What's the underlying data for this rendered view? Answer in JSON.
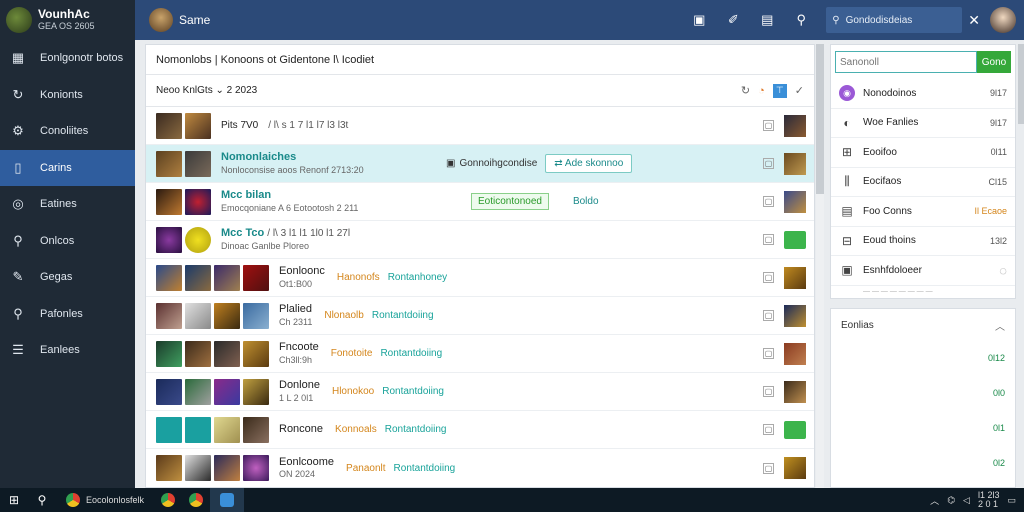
{
  "brand": {
    "title": "VounhAc",
    "subtitle": "GEA OS 2605"
  },
  "sidebar": {
    "items": [
      {
        "label": "Eonlgonotr botos",
        "icon": "grid-icon"
      },
      {
        "label": "Konionts",
        "icon": "refresh-icon"
      },
      {
        "label": "Conoliites",
        "icon": "gear-icon"
      },
      {
        "label": "Carins",
        "icon": "document-icon",
        "active": true
      },
      {
        "label": "Eatines",
        "icon": "compass-icon"
      },
      {
        "label": "Onlcos",
        "icon": "search-icon"
      },
      {
        "label": "Gegas",
        "icon": "wrench-icon"
      },
      {
        "label": "Pafonles",
        "icon": "pin-icon"
      },
      {
        "label": "Eanlees",
        "icon": "list-icon"
      }
    ]
  },
  "topbar": {
    "title": "Same",
    "search_text": "Gondodisdeias",
    "close": "✕"
  },
  "main": {
    "header": "Nomonlobs | Konoons ot Gidentone l\\ Icodiet",
    "subheader": "Neoo KnlGts ⌄ 2 2023",
    "rows": [
      {
        "title": "Pits 7V0",
        "meta": "/ l\\ s 1 7 l1 l7 l3 l3t",
        "style": "plain"
      },
      {
        "title": "Nomonlaiches",
        "sub": "Nonloconsise aoos Renonf 2713:20",
        "style": "highlight",
        "mid_label": "Gonnoihgcondise",
        "mid_button": "Ade skonnoo"
      },
      {
        "title": "Mcc bilan",
        "sub": "Emocqoniane A 6 Eotootosh 2 211",
        "style": "badge",
        "badge": "Eoticontonoed",
        "badge2": "Boldo"
      },
      {
        "title": "Mcc Tco",
        "meta": "/ l\\ 3 l1 l1 1l0 l1 27l",
        "sub": "Dinoac Ganlbe Ploreo",
        "style": "plain"
      },
      {
        "title": "Eonloonc",
        "sub": "Ot1:B00",
        "tag1": "Hanonofs",
        "tag2": "Rontanhoney"
      },
      {
        "title": "Plalied",
        "sub": "Ch 2311",
        "tag1": "Nlonaolb",
        "tag2": "Rontantdoiing"
      },
      {
        "title": "Fncoote",
        "sub": "Ch3ll:9h",
        "tag1": "Fonotoite",
        "tag2": "Rontantdoiing"
      },
      {
        "title": "Donlone",
        "sub": "1 L 2 0l1",
        "tag1": "Hlonokoo",
        "tag2": "Rontantdoiing"
      },
      {
        "title": "Roncone",
        "sub": "",
        "tag1": "Konnoals",
        "tag2": "Rontantdoiing"
      },
      {
        "title": "Eonlcoome",
        "sub": "ON 2024",
        "tag1": "Panaonlt",
        "tag2": "Rontantdoiing"
      }
    ]
  },
  "right_panel": {
    "search_placeholder": "Sanonoll",
    "go_label": "Gono",
    "items": [
      {
        "label": "Nonodoinos",
        "value": "9l17"
      },
      {
        "label": "Woe Fanlies",
        "value": "9l17"
      },
      {
        "label": "Eooifoo",
        "value": "0l11"
      },
      {
        "label": "Eocifaos",
        "value": "Cl15"
      },
      {
        "label": "Foo Conns",
        "value": "Il Ecaoe"
      },
      {
        "label": "Eoud thoins",
        "value": "13l2"
      },
      {
        "label": "Esnhfdoloeer",
        "value": ""
      }
    ],
    "footer_dash": "— — — — — — — —",
    "section2": {
      "header": "Eonlias",
      "values": [
        "0l12",
        "0l0",
        "0l1",
        "0l2"
      ]
    }
  },
  "taskbar": {
    "app_label": "Eocolonlosfelk",
    "time": "l1 2l3",
    "date": "2 0 1"
  }
}
